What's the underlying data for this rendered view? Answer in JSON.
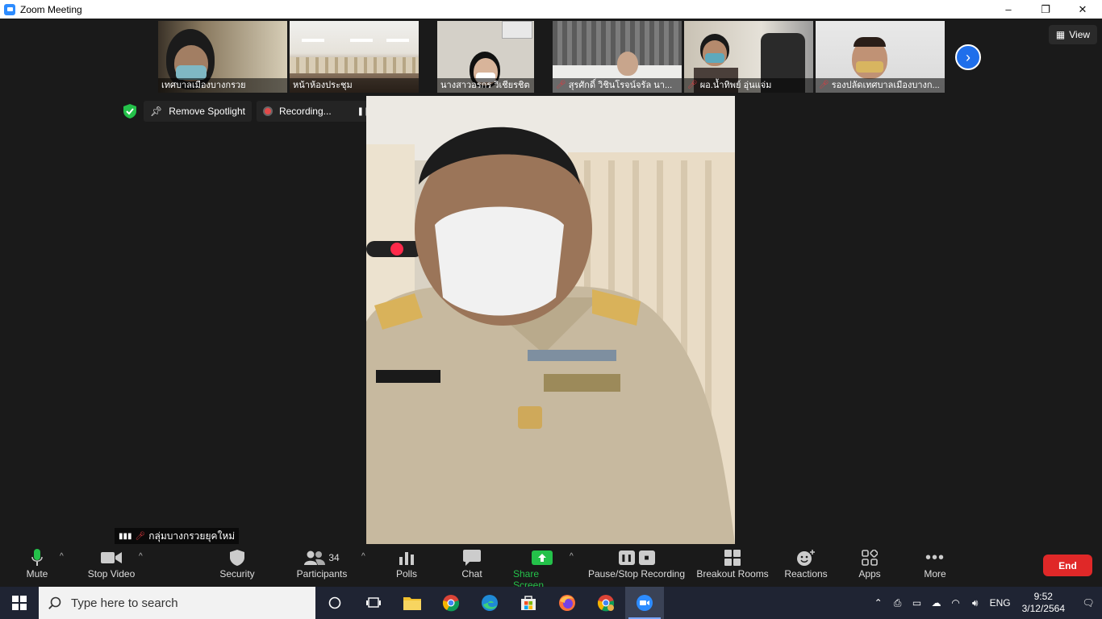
{
  "window": {
    "title": "Zoom Meeting",
    "minimize": "–",
    "restore": "❐",
    "close": "✕"
  },
  "view_button": {
    "label": "View"
  },
  "thumbnails": [
    {
      "name": "เทศบาลเมืองบางกรวย",
      "muted": false
    },
    {
      "name": "หน้าห้องประชุม",
      "muted": false
    },
    {
      "name": "นางสาวอรกร วิเชียรชิต",
      "muted": false
    },
    {
      "name": "สุรศักดิ์ วิชินโรจน์จรัล นา...",
      "muted": true
    },
    {
      "name": "ผอ.น้ำทิพย์ อุ่นแจ่ม",
      "muted": true
    },
    {
      "name": "รองปลัดเทศบาลเมืองบางก...",
      "muted": true
    }
  ],
  "status": {
    "remove_spotlight": "Remove Spotlight",
    "recording": "Recording..."
  },
  "speaker_label": "กลุ่มบางกรวยยุคใหม่",
  "toolbar": {
    "mute": "Mute",
    "stop_video": "Stop Video",
    "security": "Security",
    "participants": "Participants",
    "participants_count": "34",
    "polls": "Polls",
    "chat": "Chat",
    "share_screen": "Share Screen",
    "pause_stop_recording": "Pause/Stop Recording",
    "breakout_rooms": "Breakout Rooms",
    "reactions": "Reactions",
    "apps": "Apps",
    "more": "More",
    "end": "End"
  },
  "taskbar": {
    "search_placeholder": "Type here to search",
    "language": "ENG",
    "time": "9:52",
    "date": "3/12/2564"
  },
  "colors": {
    "accent": "#2d8cff",
    "share_green": "#24c14a",
    "end_red": "#e02828",
    "taskbar": "#1f2433"
  }
}
